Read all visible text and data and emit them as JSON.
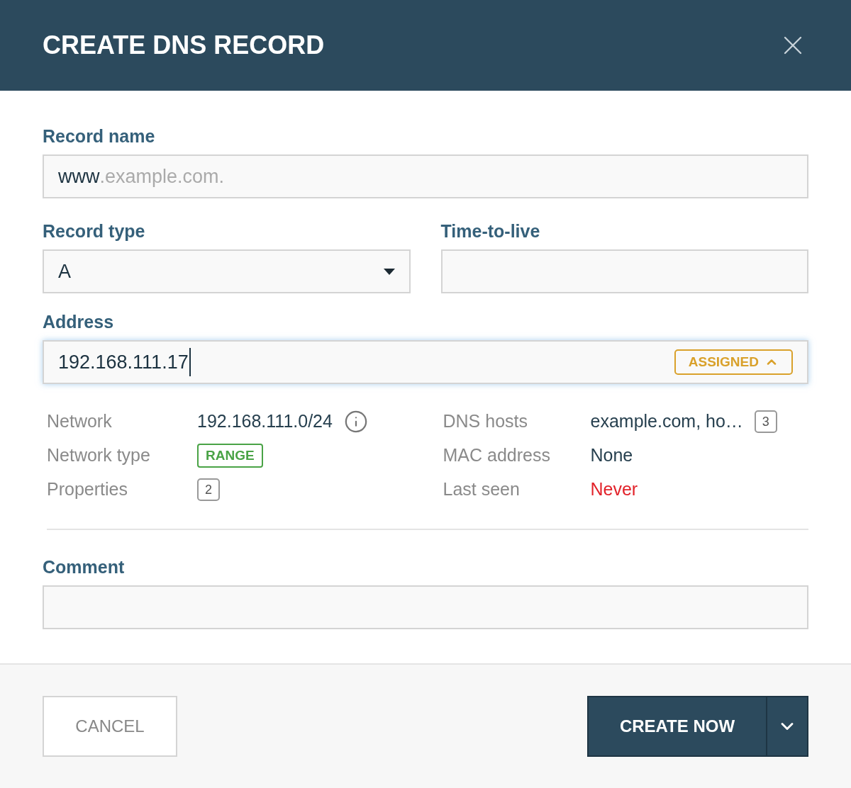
{
  "dialog": {
    "title": "CREATE DNS RECORD"
  },
  "record_name": {
    "label": "Record name",
    "value": "www",
    "suffix": ".example.com."
  },
  "record_type": {
    "label": "Record type",
    "value": "A"
  },
  "ttl": {
    "label": "Time-to-live"
  },
  "address": {
    "label": "Address",
    "value": "192.168.111.17",
    "focused": true,
    "status": "ASSIGNED",
    "expanded": true
  },
  "details_left": [
    {
      "label": "Network",
      "kind": "info",
      "value": "192.168.111.0/24"
    },
    {
      "label": "Network type",
      "kind": "tag",
      "value": "RANGE"
    },
    {
      "label": "Properties",
      "kind": "count",
      "count": "2"
    }
  ],
  "details_right": [
    {
      "label": "DNS hosts",
      "kind": "text-count",
      "value": "example.com, ho…",
      "count": "3"
    },
    {
      "label": "MAC address",
      "kind": "text",
      "value": "None"
    },
    {
      "label": "Last seen",
      "kind": "alert",
      "value": "Never"
    }
  ],
  "comment": {
    "label": "Comment"
  },
  "buttons": {
    "cancel": "CANCEL",
    "create": "CREATE NOW"
  }
}
